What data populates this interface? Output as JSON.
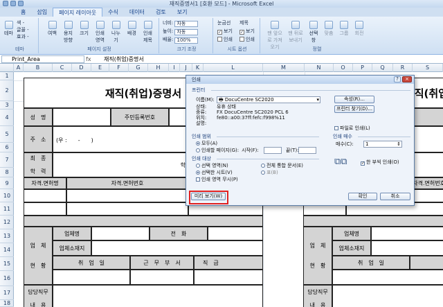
{
  "window": {
    "title": "재직증명서1 [호환 모드] - Microsoft Excel"
  },
  "tabs": [
    "홈",
    "삽입",
    "페이지 레이아웃",
    "수식",
    "데이터",
    "검토",
    "보기"
  ],
  "active_tab": "페이지 레이아웃",
  "ribbon": {
    "theme_group": {
      "label": "테마",
      "btn": "테마",
      "items": [
        "색 -",
        "글꼴 -",
        "효과 -"
      ]
    },
    "page_setup": {
      "label": "페이지 설정",
      "buttons": [
        "여백",
        "용지 방향",
        "크기",
        "인쇄 영역",
        "나누기",
        "배경",
        "인쇄 제목"
      ]
    },
    "scale": {
      "label": "크기 조정",
      "width_label": "너비:",
      "width_val": "자동",
      "height_label": "높이:",
      "height_val": "자동",
      "scale_label": "배율:",
      "scale_val": "100%"
    },
    "sheet_opts": {
      "label": "시트 옵션",
      "gridlines": "눈금선",
      "headings": "제목",
      "view": "보기",
      "print": "인쇄"
    },
    "arrange": {
      "label": "정렬",
      "buttons": [
        "맨 앞으로 가져오기",
        "맨 뒤로 보내기",
        "선택 창",
        "맞춤",
        "그룹",
        "회전"
      ]
    }
  },
  "formula_bar": {
    "namebox": "Print_Area",
    "fx": "fx",
    "content": "재직(취업)증명서"
  },
  "columns": [
    "A",
    "B",
    "C",
    "D",
    "E",
    "F",
    "G",
    "H",
    "I",
    "J",
    "K",
    "L",
    "M",
    "N",
    "O",
    "P",
    "Q",
    "R",
    "S"
  ],
  "rows": [
    "1",
    "2",
    "3",
    "4",
    "5",
    "6",
    "7",
    "8",
    "9",
    "10",
    "11",
    "12",
    "13",
    "14",
    "15",
    "16",
    "17",
    "18"
  ],
  "form": {
    "title": "재직(취업)증명서",
    "title_right": "재직(취업",
    "name": "성　명",
    "resident_no": "주민등록번호",
    "address": "주　소",
    "address_val": "(우 :　　-　　)",
    "education_1": "최　종",
    "education_2": "학　력",
    "school": "학교",
    "license": "자격.면허명",
    "license_no": "자격.면허번호",
    "company": "업체명",
    "phone": "전　화",
    "company_addr": "업체소재지",
    "status_1": "업　체",
    "status_2": "현　황",
    "hire_date": "취　업　일",
    "dept": "근　무　부　서",
    "position": "직　급",
    "duty": "담당직무",
    "content": "내　용",
    "right_company": "업체명",
    "right_addr": "업체소재지",
    "right_hire": "취　업　일",
    "right_license_no": "자격.면허번호"
  },
  "dialog": {
    "title": "인쇄",
    "close": "×",
    "help": "?",
    "printer_section": "프린터",
    "name_label": "이름(M):",
    "printer_name": "DocuCentre SC2020",
    "status_label": "상태:",
    "status_val": "유휴 상태",
    "type_label": "종류:",
    "type_val": "FX DocuCentre SC2020 PCL 6",
    "where_label": "위치:",
    "where_val": "fe80::a00:37ff:fefc:f998%11",
    "comment_label": "설명:",
    "properties_btn": "속성(R)...",
    "find_printer_btn": "프린터 찾기(D)...",
    "print_to_file": "파일로 인쇄(L)",
    "range_section": "인쇄 범위",
    "all": "모두(A)",
    "pages": "인쇄할 페이지(G):",
    "from": "시작(F):",
    "to": "끝(T):",
    "what_section": "인쇄 대상",
    "selection": "선택 영역(N)",
    "entire_workbook": "전체 통합 문서(E)",
    "active_sheets": "선택한 시트(V)",
    "table": "표(B)",
    "ignore_print_areas": "인쇄 영역 무시(P)",
    "copies_section": "인쇄 매수",
    "copies_label": "매수(C):",
    "copies_val": "1",
    "collate": "한 부씩 인쇄(O)",
    "preview_btn": "미리 보기(W)",
    "ok_btn": "확인",
    "cancel_btn": "취소"
  }
}
